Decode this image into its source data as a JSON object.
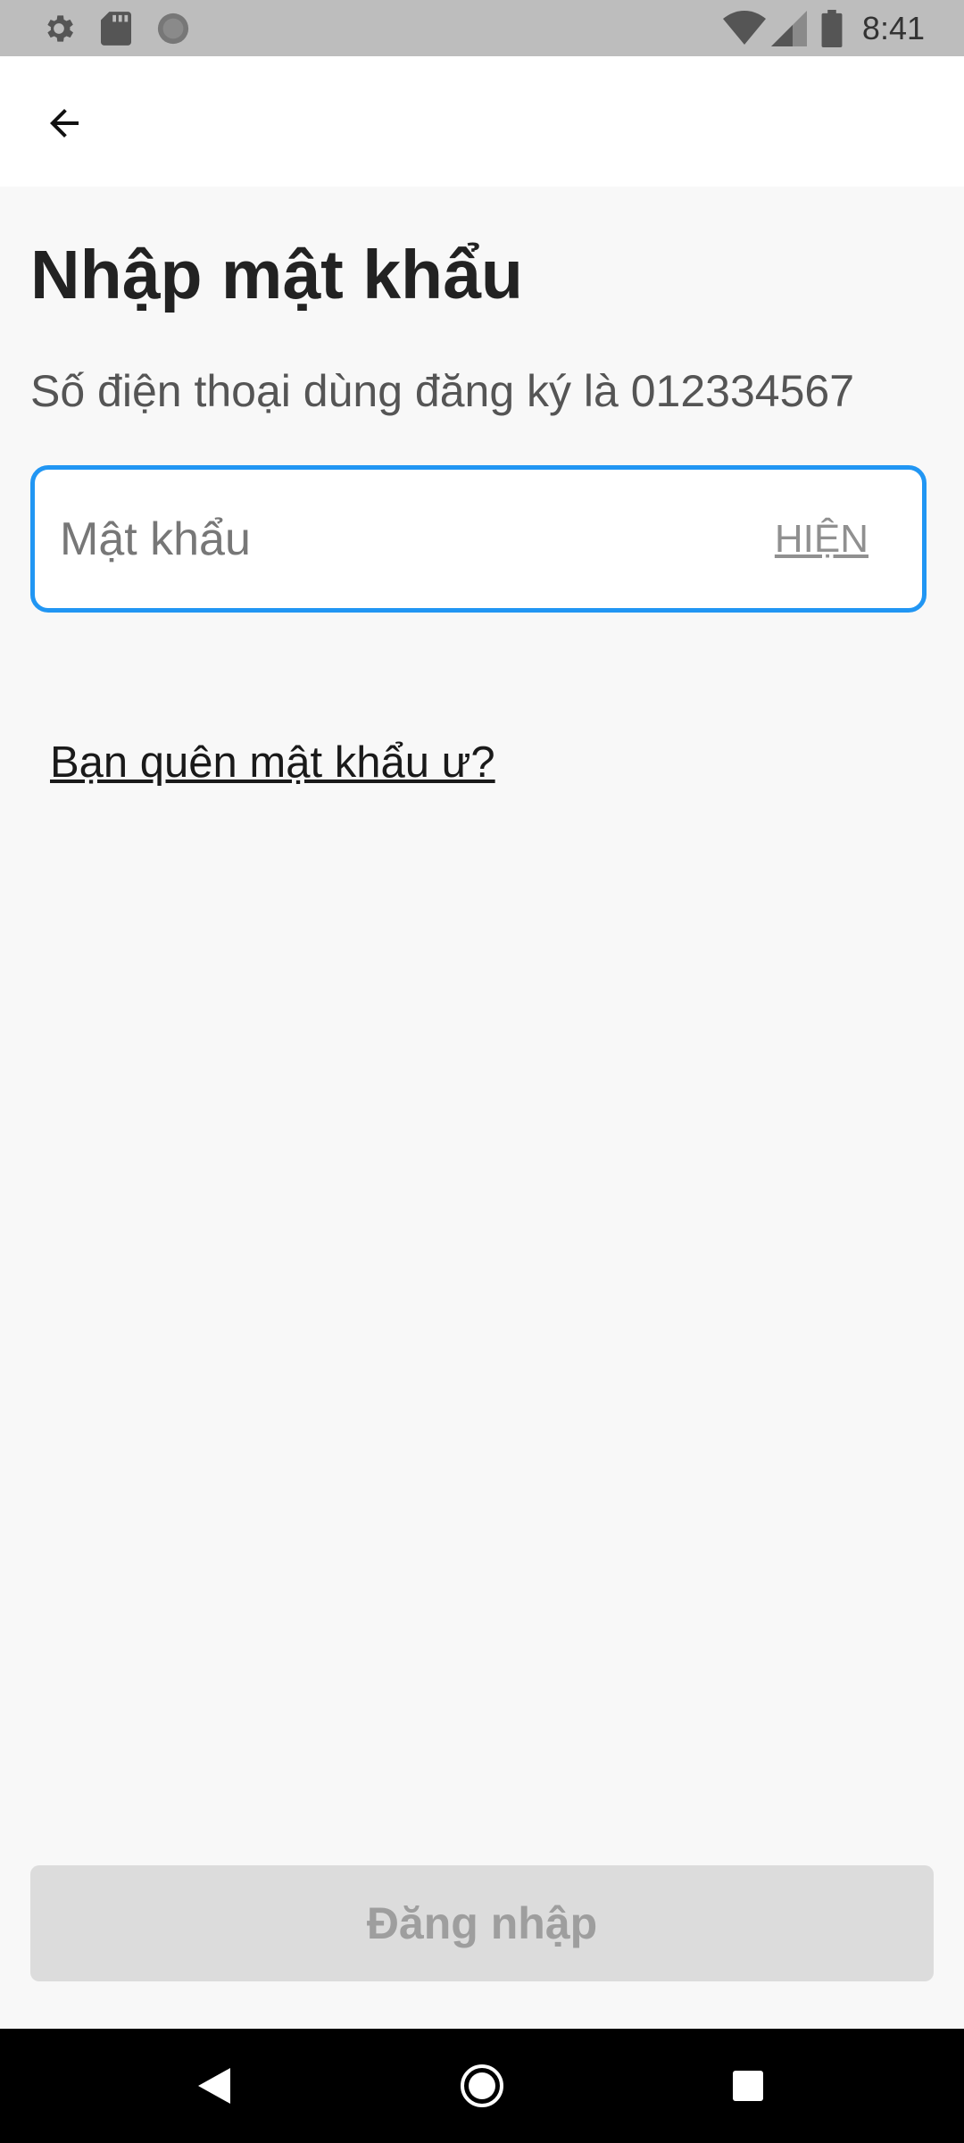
{
  "status_bar": {
    "time": "8:41",
    "icons": [
      "gear-icon",
      "sd-card-icon",
      "circle-icon",
      "wifi-icon",
      "signal-icon",
      "battery-icon"
    ]
  },
  "app_bar": {
    "back_icon": "arrow-left-icon"
  },
  "main": {
    "title": "Nhập mật khẩu",
    "subtitle": "Số điện thoại dùng đăng ký là 012334567",
    "password_field": {
      "placeholder": "Mật khẩu",
      "value": "",
      "show_label": "HIỆN"
    },
    "forgot_link": "Bạn quên mật khẩu ư?",
    "login_button": "Đăng nhập"
  },
  "nav_bar": {
    "buttons": [
      "back-triangle-icon",
      "home-circle-icon",
      "recents-square-icon"
    ]
  },
  "colors": {
    "accent": "#2196f3",
    "status_bar_bg": "#bdbdbd",
    "app_bar_bg": "#ffffff",
    "page_bg": "#f8f8f8",
    "button_disabled_bg": "#dcdcdc",
    "button_disabled_text": "#9e9e9e",
    "nav_bar_bg": "#000000"
  }
}
